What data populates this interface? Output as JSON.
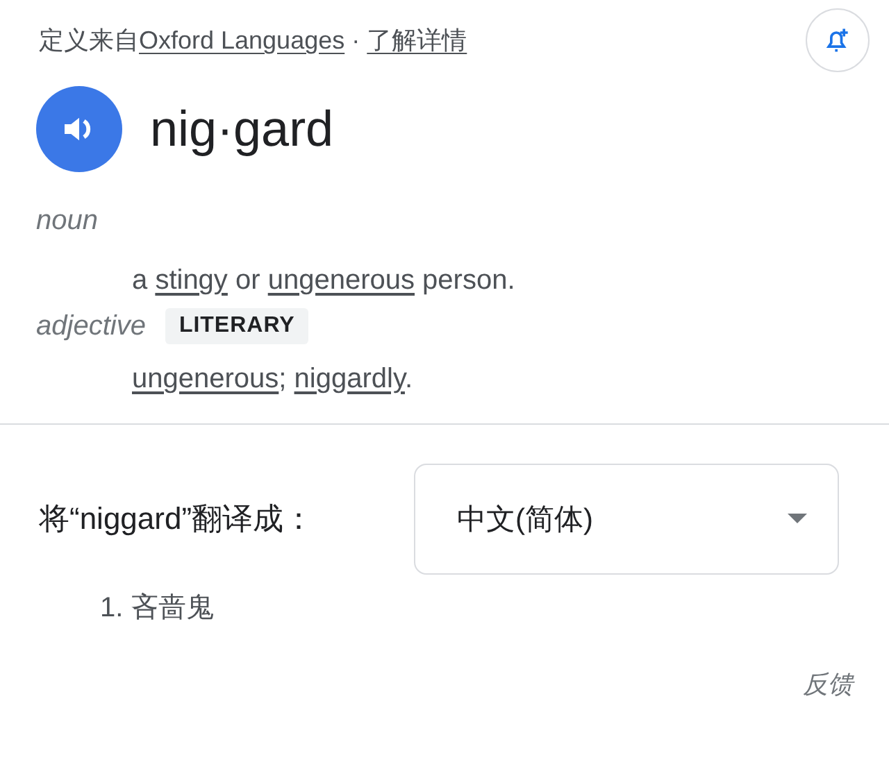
{
  "source": {
    "prefix": "定义来自",
    "link": "Oxford Languages",
    "separator": "·",
    "more": "了解详情"
  },
  "headword": "nig·gard",
  "senses": [
    {
      "pos": "noun",
      "parts": [
        {
          "text": "a ",
          "link": false
        },
        {
          "text": "stingy",
          "link": true
        },
        {
          "text": " or ",
          "link": false
        },
        {
          "text": "ungenerous",
          "link": true
        },
        {
          "text": " person.",
          "link": false
        }
      ]
    },
    {
      "pos": "adjective",
      "register": "LITERARY",
      "parts": [
        {
          "text": "ungenerous",
          "link": true
        },
        {
          "text": "; ",
          "link": false
        },
        {
          "text": "niggardly",
          "link": true
        },
        {
          "text": ".",
          "link": false
        }
      ]
    }
  ],
  "translate": {
    "label": "将“niggard”翻译成：",
    "language": "中文(简体)",
    "results": [
      "1. 吝啬鬼"
    ]
  },
  "feedback": "反馈"
}
